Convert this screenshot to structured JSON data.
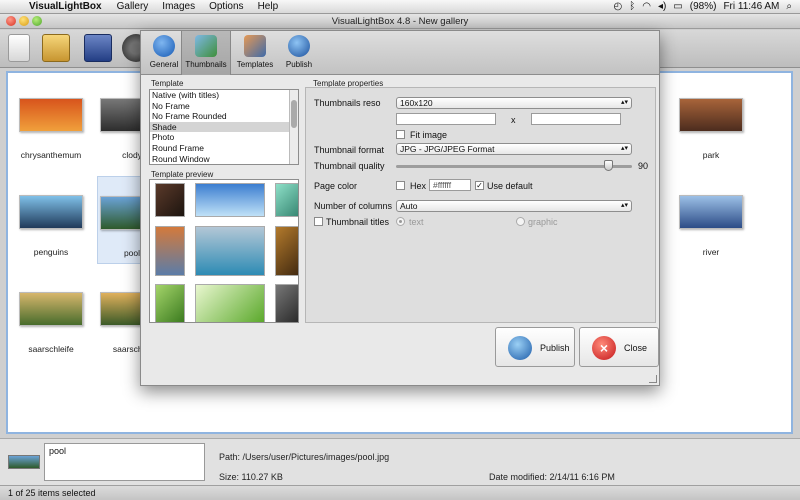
{
  "menubar": {
    "apple": "",
    "app_name": "VisualLightBox",
    "items": [
      "Gallery",
      "Images",
      "Options",
      "Help"
    ],
    "battery": "(98%)",
    "clock": "Fri 11:46 AM"
  },
  "window": {
    "title": "VisualLightBox 4.8  -  New gallery"
  },
  "gallery": {
    "thumbnails": [
      {
        "name": "chrysanthemum",
        "colors": [
          "#d8541c",
          "#f0a03b"
        ]
      },
      {
        "name": "clody",
        "colors": [
          "#777777",
          "#2d2d2d"
        ]
      },
      {
        "name": "penguins",
        "colors": [
          "#7fc0e8",
          "#203a5a"
        ]
      },
      {
        "name": "pool",
        "colors": [
          "#6aa2d6",
          "#2f5a2b"
        ]
      },
      {
        "name": "saarschleife",
        "colors": [
          "#d7b66c",
          "#486c2c"
        ]
      },
      {
        "name": "saarschlei",
        "colors": [
          "#e0b05c",
          "#3b5a28"
        ]
      },
      {
        "name": "park",
        "colors": [
          "#a8643a",
          "#4c2c1e"
        ]
      },
      {
        "name": "river",
        "colors": [
          "#9cc0e6",
          "#2c4c86"
        ]
      }
    ]
  },
  "dialog": {
    "tabs": [
      {
        "label": "General"
      },
      {
        "label": "Thumbnails"
      },
      {
        "label": "Templates"
      },
      {
        "label": "Publish"
      }
    ],
    "template_section_label": "Template",
    "templates": [
      "Native (with titles)",
      "No Frame",
      "No Frame Rounded",
      "Shade",
      "Photo",
      "Round Frame",
      "Round Window"
    ],
    "selected_template": "Shade",
    "preview_label": "Template preview",
    "props_label": "Template properties",
    "props": {
      "reso_label": "Thumbnails reso",
      "reso_value": "160x120",
      "reso_x": "x",
      "fit_label": "Fit image",
      "format_label": "Thumbnail format",
      "format_value": "JPG - JPG/JPEG Format",
      "quality_label": "Thumbnail quality",
      "quality_value": "90",
      "quality": 0.9,
      "color_label": "Page color",
      "hex_label": "Hex",
      "hex_value": "#ffffff",
      "use_default_label": "Use default",
      "use_default_checked": true,
      "columns_label": "Number of columns",
      "columns_value": "Auto",
      "titles_label": "Thumbnail titles",
      "title_text": "text",
      "title_graphic": "graphic"
    },
    "publish_label": "Publish",
    "close_label": "Close"
  },
  "info": {
    "name": "pool",
    "path": "Path: /Users/user/Pictures/images/pool.jpg",
    "size": "Size:    110.27 KB",
    "date": "Date modified: 2/14/11 6:16 PM"
  },
  "status": {
    "text": "1 of 25 items selected"
  }
}
